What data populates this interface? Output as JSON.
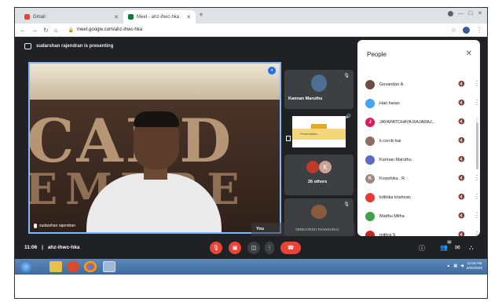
{
  "browser": {
    "tabs": [
      {
        "label": "Gmail",
        "active": false
      },
      {
        "label": "Meet - ahz-ihwc-hka",
        "active": true
      }
    ],
    "new_tab": "+",
    "url": "meet.google.com/ahz-ihwc-hka"
  },
  "meet": {
    "presenting_banner": "sudarshan rajendran is presenting",
    "main_tile_name": "sudarshan rajendran",
    "bg_letters_top": "CADD",
    "bg_letters_bottom": "EMBRE",
    "tiles": [
      {
        "name": "Kannan Maruthu"
      },
      {
        "name": "Presentation",
        "slide_text": "Presentation"
      },
      {
        "name": "26 others",
        "avatar_letter": "K"
      },
      {
        "name": "You",
        "subname": "VENKATESH THANGARAJ"
      }
    ],
    "controls": {
      "time": "11:06",
      "separator": "|",
      "meeting_id": "ahz-ihwc-hka",
      "people_count": "30"
    }
  },
  "people_panel": {
    "title": "People",
    "participants": [
      {
        "name": "Govandan A",
        "color": "#6d4c41",
        "letter": ""
      },
      {
        "name": "Hari haran",
        "color": "#42a5f5",
        "letter": ""
      },
      {
        "name": "JAYAPATCHAYA RAJARAJ...",
        "color": "#d81b60",
        "letter": "J"
      },
      {
        "name": "k.corcki bai",
        "color": "#8d6e63",
        "letter": ""
      },
      {
        "name": "Kannan Maruthu",
        "color": "#5c6bc0",
        "letter": ""
      },
      {
        "name": "Kowshika . R",
        "color": "#a1887f",
        "letter": "K"
      },
      {
        "name": "krithika krishnan",
        "color": "#e53935",
        "letter": ""
      },
      {
        "name": "Madhu Mitha",
        "color": "#43a047",
        "letter": ""
      },
      {
        "name": "mithra S",
        "color": "#c62828",
        "letter": ""
      }
    ]
  },
  "taskbar": {
    "clock_time": "11:06 AM",
    "clock_date": "8/25/2020"
  },
  "colors": {
    "meet_bg": "#202124",
    "accent": "#1a73e8",
    "end_call": "#ea4335"
  }
}
